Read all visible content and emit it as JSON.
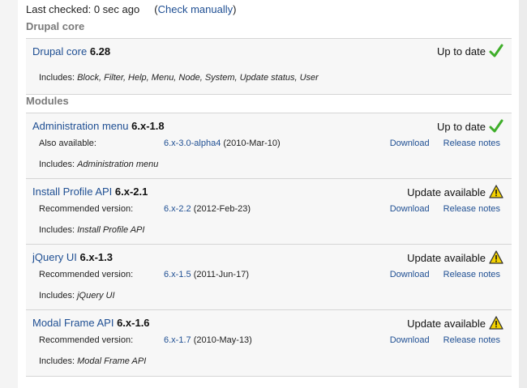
{
  "header": {
    "last_checked": "Last checked: 0 sec ago",
    "check_manually_prefix": "(",
    "check_manually": "Check manually",
    "check_manually_suffix": ")"
  },
  "sections": {
    "core_title": "Drupal core",
    "modules_title": "Modules"
  },
  "core": {
    "name": "Drupal core",
    "version": "6.28",
    "status": "Up to date",
    "includes_label": "Includes:",
    "includes": "Block, Filter, Help, Menu, Node, System, Update status, User"
  },
  "modules": [
    {
      "name": "Administration menu",
      "version": "6.x-1.8",
      "status": "Up to date",
      "row_label": "Also available:",
      "row_version": "6.x-3.0-alpha4",
      "row_date": "(2010-Mar-10)",
      "download": "Download",
      "release_notes": "Release notes",
      "includes_label": "Includes:",
      "includes": "Administration menu"
    },
    {
      "name": "Install Profile API",
      "version": "6.x-2.1",
      "status": "Update available",
      "row_label": "Recommended version:",
      "row_version": "6.x-2.2",
      "row_date": "(2012-Feb-23)",
      "download": "Download",
      "release_notes": "Release notes",
      "includes_label": "Includes:",
      "includes": "Install Profile API"
    },
    {
      "name": "jQuery UI",
      "version": "6.x-1.3",
      "status": "Update available",
      "row_label": "Recommended version:",
      "row_version": "6.x-1.5",
      "row_date": "(2011-Jun-17)",
      "download": "Download",
      "release_notes": "Release notes",
      "includes_label": "Includes:",
      "includes": "jQuery UI"
    },
    {
      "name": "Modal Frame API",
      "version": "6.x-1.6",
      "status": "Update available",
      "row_label": "Recommended version:",
      "row_version": "6.x-1.7",
      "row_date": "(2010-May-13)",
      "download": "Download",
      "release_notes": "Release notes",
      "includes_label": "Includes:",
      "includes": "Modal Frame API"
    }
  ],
  "colors": {
    "link": "#1f4f93",
    "ok": "#3fae2a",
    "warn_fill": "#f4d200",
    "section_title": "#7a7a7a"
  },
  "icons": {
    "ok": "check-icon",
    "warn": "warning-icon"
  }
}
